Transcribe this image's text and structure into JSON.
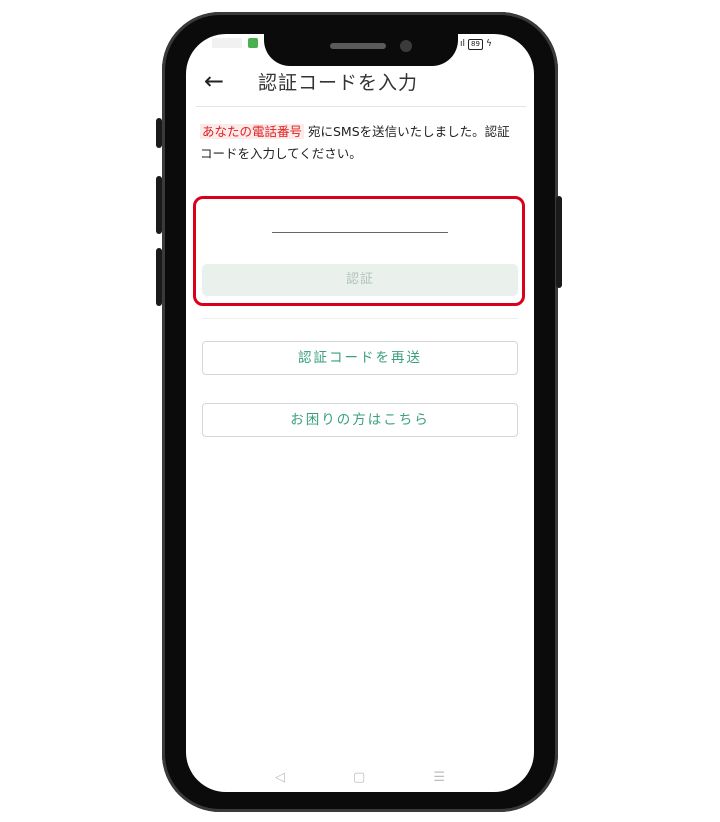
{
  "status_bar": {
    "battery": "89"
  },
  "header": {
    "back_icon": "←",
    "title": "認証コードを入力"
  },
  "message": {
    "phone_label": "あなたの電話番号",
    "text": " 宛にSMSを送信いたしました。認証コードを入力してください。"
  },
  "code_input": {
    "value": "",
    "placeholder": ""
  },
  "verify_button": {
    "label": "認証"
  },
  "resend_button": {
    "label": "認証コードを再送"
  },
  "help_button": {
    "label": "お困りの方はこちら"
  },
  "nav": {
    "back": "◁",
    "home": "▢",
    "menu": "☰"
  },
  "colors": {
    "highlight": "#d9001b",
    "accent": "#3aa17a",
    "disabled_btn": "#eaf0ec"
  }
}
